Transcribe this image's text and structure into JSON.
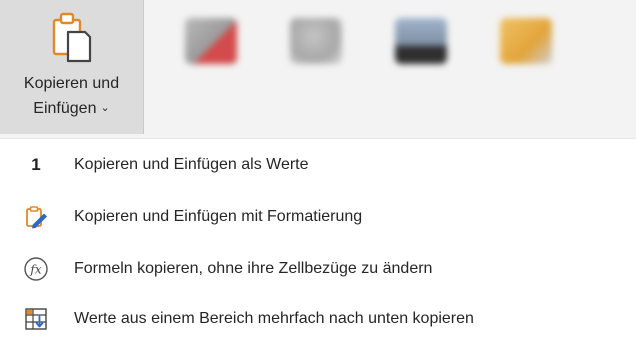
{
  "ribbon": {
    "copy_paste_button": {
      "label_line1": "Kopieren und",
      "label_line2": "Einfügen",
      "chevron": "⌄",
      "icon": "clipboard-icon"
    },
    "blurred_groups": [
      {
        "label": "",
        "icon": "blurred-icon-red"
      },
      {
        "label": "",
        "icon": "blurred-icon-grey"
      },
      {
        "label": "",
        "icon": "blurred-icon-fill"
      },
      {
        "label": "",
        "icon": "blurred-icon-brush"
      }
    ]
  },
  "menu": {
    "items": [
      {
        "icon": "number-1",
        "icon_text": "1",
        "label": "Kopieren und Einfügen als Werte"
      },
      {
        "icon": "paste-format-icon",
        "label": "Kopieren und Einfügen mit Formatierung"
      },
      {
        "icon": "formula-fx-icon",
        "label": "Formeln kopieren, ohne ihre Zellbezüge zu ändern"
      },
      {
        "icon": "fill-down-icon",
        "label": "Werte aus einem Bereich mehrfach nach unten kopieren"
      }
    ]
  },
  "colors": {
    "ribbon_bg": "#f3f3f3",
    "button_pressed_bg": "#dcdcdc",
    "clipboard_orange": "#e0892a",
    "icon_blue": "#2f67c2"
  }
}
